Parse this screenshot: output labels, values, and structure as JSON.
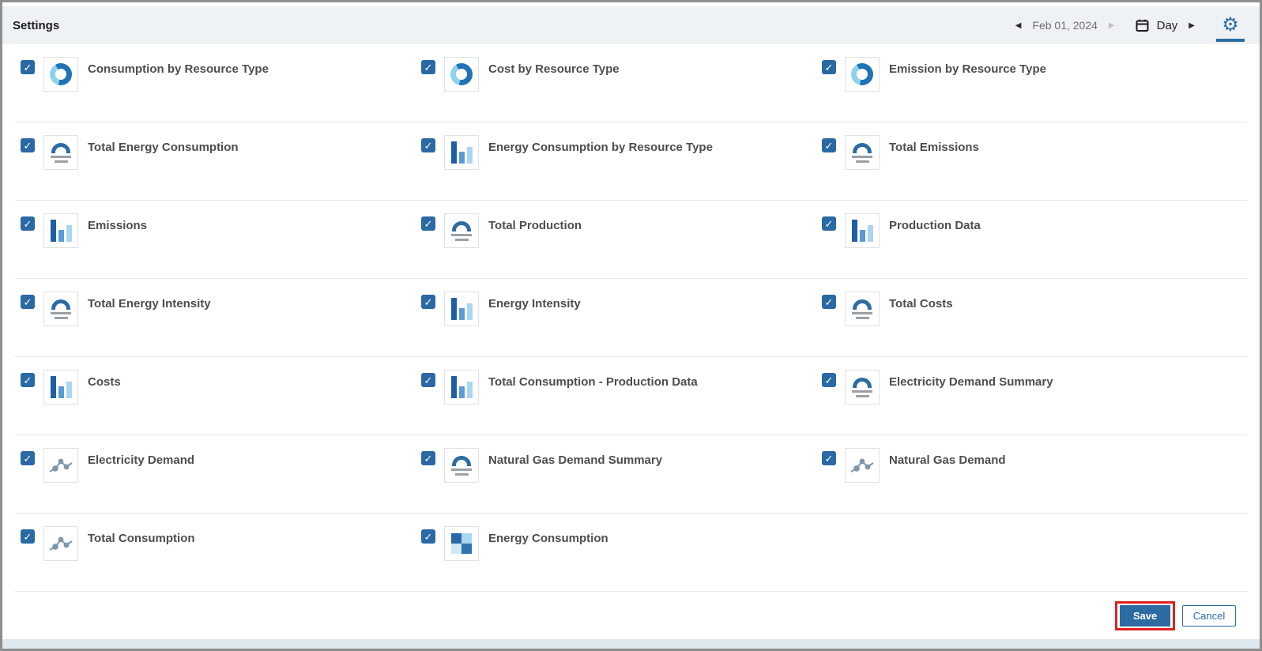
{
  "header": {
    "title": "Settings",
    "date": "Feb 01, 2024",
    "period": "Day"
  },
  "glyphs": {
    "prev_arrow": "◀",
    "next_arrow": "▶",
    "gear": "⚙",
    "check": "✓"
  },
  "grid": {
    "rows": [
      [
        {
          "icon": "donut",
          "label": "Consumption by Resource Type",
          "checked": true
        },
        {
          "icon": "donut",
          "label": "Cost by Resource Type",
          "checked": true
        },
        {
          "icon": "donut",
          "label": "Emission by Resource Type",
          "checked": true
        }
      ],
      [
        {
          "icon": "gauge",
          "label": "Total Energy Consumption",
          "checked": true
        },
        {
          "icon": "bars",
          "label": "Energy Consumption by Resource Type",
          "checked": true
        },
        {
          "icon": "gauge",
          "label": "Total Emissions",
          "checked": true
        }
      ],
      [
        {
          "icon": "bars",
          "label": "Emissions",
          "checked": true
        },
        {
          "icon": "gauge",
          "label": "Total Production",
          "checked": true
        },
        {
          "icon": "bars",
          "label": "Production Data",
          "checked": true
        }
      ],
      [
        {
          "icon": "gauge",
          "label": "Total Energy Intensity",
          "checked": true
        },
        {
          "icon": "bars",
          "label": "Energy Intensity",
          "checked": true
        },
        {
          "icon": "gauge",
          "label": "Total Costs",
          "checked": true
        }
      ],
      [
        {
          "icon": "bars",
          "label": "Costs",
          "checked": true
        },
        {
          "icon": "bars",
          "label": "Total Consumption - Production Data",
          "checked": true
        },
        {
          "icon": "gauge",
          "label": "Electricity Demand Summary",
          "checked": true
        }
      ],
      [
        {
          "icon": "line",
          "label": "Electricity Demand",
          "checked": true
        },
        {
          "icon": "gauge",
          "label": "Natural Gas Demand Summary",
          "checked": true
        },
        {
          "icon": "line",
          "label": "Natural Gas Demand",
          "checked": true
        }
      ],
      [
        {
          "icon": "line",
          "label": "Total Consumption",
          "checked": true
        },
        {
          "icon": "heatmap",
          "label": "Energy Consumption",
          "checked": true
        }
      ]
    ]
  },
  "footer": {
    "save_label": "Save",
    "cancel_label": "Cancel"
  },
  "icon_names": {
    "donut": "donut-chart-icon",
    "gauge": "gauge-summary-icon",
    "bars": "bar-chart-icon",
    "line": "line-chart-icon",
    "heatmap": "heatmap-icon"
  },
  "colors": {
    "accent_blue": "#2d6ca2",
    "checkbox_blue": "#2a69a3",
    "save_highlight_red": "#e02020",
    "icon_dark_blue": "#1d5fa7",
    "icon_medium_blue": "#5b9bd5",
    "icon_light_blue": "#aad6f2",
    "line_icon_gray_blue": "#7d96a9",
    "header_bg": "#eef2f5",
    "bottom_strip": "#dde8ef"
  }
}
